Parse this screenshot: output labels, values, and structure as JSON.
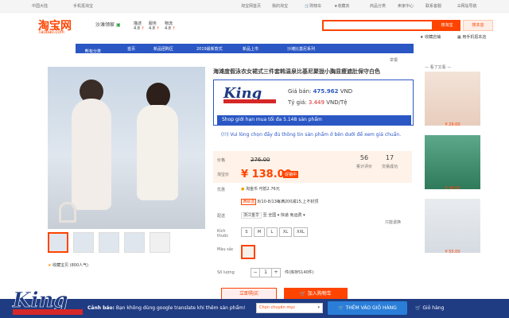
{
  "topbar": {
    "region": "中国大陆",
    "mobile": "手机逛淘宝",
    "home": "淘宝网首页",
    "mytaobao": "我的淘宝",
    "cart": "购物车",
    "fav": "收藏夹",
    "category": "商品分类",
    "seller": "卖家中心",
    "contact": "联系客服",
    "sitemap": "网站导航"
  },
  "logo": {
    "main": "淘宝网",
    "sub": "Taobao.com"
  },
  "shop": {
    "name": "沙滩领家",
    "ratings": [
      {
        "label": "描述",
        "value": "4.8"
      },
      {
        "label": "服务",
        "value": "4.8"
      },
      {
        "label": "物流",
        "value": "4.8"
      }
    ]
  },
  "search": {
    "placeholder": "",
    "btn": "搜淘宝",
    "shop_btn": "搜本店"
  },
  "favorites": {
    "store": "收藏店铺",
    "phone": "用手机逛本店"
  },
  "navbar": [
    "所有分类",
    "首页",
    "新品团购区",
    "2019最新款式",
    "新品上市",
    "沙滩比基尼系列"
  ],
  "report": "举报",
  "product": {
    "title": "海滩度假泳衣女裙式三件套韩温泉比基尼聚拢小胸显瘦遮肚保守白色",
    "collect": "收藏宝贝 (800人气)"
  },
  "king": {
    "price_label": "Giá bán:",
    "price_value": "475.962",
    "price_unit": "VND",
    "rate_label": "Tỷ giá:",
    "rate_value": "3.449",
    "rate_unit": "VND/Tệ",
    "limit": "Shop giới hạn mua tối đa 5.148 sản phẩm",
    "notice": "(!!) Vui lòng chọn đầy đủ thông tin sản phẩm ở bên dưới để xem giá chuẩn."
  },
  "pricing": {
    "orig_label": "价格",
    "orig": "276.00",
    "now_label": "淘宝价",
    "now": "138.00",
    "badge": "促销中",
    "reviews": "56",
    "reviews_label": "累计评价",
    "sales": "17",
    "sales_label": "交易成功"
  },
  "promo": {
    "label": "优惠",
    "text": "淘金币 可抵2.76元",
    "note": "8/10-8/13每满200减15,上不封顶",
    "tag": "满就送",
    "delivery_label": "配送",
    "delivery_from": "浙江金华",
    "delivery_to": "至 全国",
    "express": "快递 免运费",
    "days": "只能退换"
  },
  "options": {
    "size_label": "Kích thước",
    "sizes": [
      "S",
      "M",
      "L",
      "XL",
      "XXL"
    ],
    "color_label": "Màu sắc",
    "qty_label": "Số lượng",
    "qty": "1",
    "stock": "件(库存5140件)"
  },
  "buttons": {
    "buy": "立即购买",
    "cart": "加入购物车"
  },
  "sidebar": {
    "head": "看了又看",
    "prices": [
      "¥ 29.00",
      "¥ 48.00",
      "¥ 55.00"
    ]
  },
  "bottom": {
    "warn_bold": "Cảnh báo:",
    "warn": " Bạn không dùng google translate khi thêm sản phẩm!",
    "select": "Chọn chuyên mục",
    "add_btn": "THÊM VÀO GIỎ HÀNG",
    "cart": "Giỏ hàng"
  },
  "colors": {
    "accent": "#ff4400",
    "king_blue": "#2a57c4",
    "bottom": "#1f3b82"
  }
}
